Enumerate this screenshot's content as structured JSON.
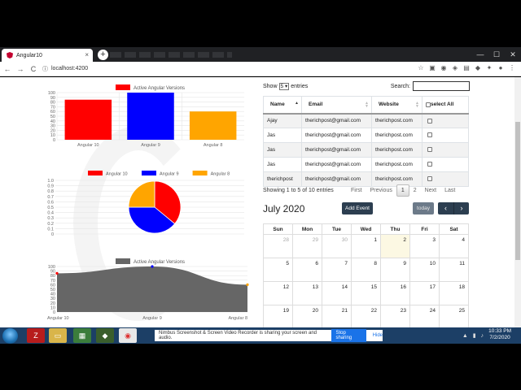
{
  "browser": {
    "tab_title": "Angular10",
    "tab_close": "×",
    "new_tab": "+",
    "url": "localhost:4200",
    "back": "←",
    "forward": "→",
    "reload": "C",
    "window_buttons": [
      "—",
      "☐",
      "✕"
    ]
  },
  "bar_chart": {
    "legend_label": "Active Angular Versions",
    "y_ticks": [
      "100",
      "90",
      "80",
      "70",
      "60",
      "50",
      "40",
      "30",
      "20",
      "10",
      "0"
    ]
  },
  "pie_chart": {
    "y_ticks": [
      "1.0",
      "0.9",
      "0.8",
      "0.7",
      "0.6",
      "0.5",
      "0.4",
      "0.3",
      "0.2",
      "0.1",
      "0"
    ]
  },
  "area_chart": {
    "legend_label": "Active Angular Versions",
    "y_ticks": [
      "100",
      "90",
      "80",
      "70",
      "60",
      "50",
      "40",
      "30",
      "20",
      "10",
      "0"
    ]
  },
  "chart_data": [
    {
      "type": "bar",
      "categories": [
        "Angular 10",
        "Angular 9",
        "Angular 8"
      ],
      "series": [
        {
          "name": "Active Angular Versions",
          "values": [
            85,
            100,
            60
          ]
        }
      ],
      "colors": [
        "#ff0000",
        "#0000ff",
        "#ffa500"
      ],
      "ylim": [
        0,
        100
      ]
    },
    {
      "type": "pie",
      "categories": [
        "Angular 10",
        "Angular 9",
        "Angular 8"
      ],
      "values": [
        36,
        39,
        25
      ],
      "colors": [
        "#ff0000",
        "#0000ff",
        "#ffa500"
      ]
    },
    {
      "type": "area",
      "categories": [
        "Angular 10",
        "Angular 9",
        "Angular 8"
      ],
      "series": [
        {
          "name": "Active Angular Versions",
          "values": [
            85,
            100,
            60
          ]
        }
      ],
      "fill": "#666666",
      "point_colors": [
        "#ff0000",
        "#0000ff",
        "#ffa500"
      ],
      "ylim": [
        0,
        100
      ]
    }
  ],
  "datatable": {
    "show_label": "Show",
    "show_value": "5",
    "entries_label": "entries",
    "search_label": "Search:",
    "headers": [
      "Name",
      "Email",
      "Website",
      "select All"
    ],
    "rows": [
      {
        "name": "Ajay",
        "email": "therichpost@gmail.com",
        "website": "therichpost.com"
      },
      {
        "name": "Jas",
        "email": "therichpost@gmail.com",
        "website": "therichpost.com"
      },
      {
        "name": "Jas",
        "email": "therichpost@gmail.com",
        "website": "therichpost.com"
      },
      {
        "name": "Jas",
        "email": "therichpost@gmail.com",
        "website": "therichpost.com"
      },
      {
        "name": "therichpost",
        "email": "therichpost@gmail.com",
        "website": "therichpost.com"
      }
    ],
    "info": "Showing 1 to 5 of 10 entries",
    "pager": {
      "first": "First",
      "previous": "Previous",
      "page1": "1",
      "page2": "2",
      "next": "Next",
      "last": "Last"
    }
  },
  "calendar": {
    "title": "July 2020",
    "add_event": "Add Event",
    "today": "today",
    "prev": "‹",
    "next": "›",
    "weekdays": [
      "Sun",
      "Mon",
      "Tue",
      "Wed",
      "Thu",
      "Fri",
      "Sat"
    ],
    "weeks": [
      [
        "28",
        "29",
        "30",
        "1",
        "2",
        "3",
        "4"
      ],
      [
        "5",
        "6",
        "7",
        "8",
        "9",
        "10",
        "11"
      ],
      [
        "12",
        "13",
        "14",
        "15",
        "16",
        "17",
        "18"
      ],
      [
        "19",
        "20",
        "21",
        "22",
        "23",
        "24",
        "25"
      ]
    ]
  },
  "taskbar": {
    "share_message": "Nimbus Screenshot & Screen Video Recorder is sharing your screen and audio.",
    "stop_sharing": "Stop sharing",
    "hide": "Hide",
    "time": "10:33 PM",
    "date": "7/2/2020"
  }
}
